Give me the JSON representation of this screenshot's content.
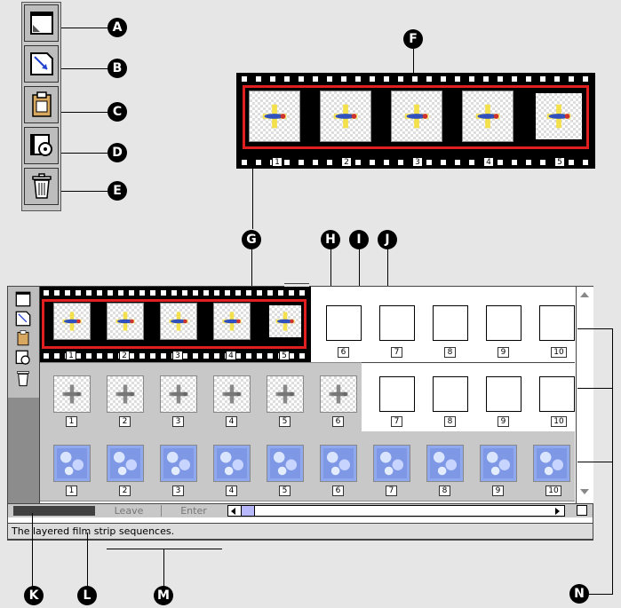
{
  "palette": {
    "tools": [
      {
        "name": "frame-tool",
        "icon": "frame-icon"
      },
      {
        "name": "arrow-tool",
        "icon": "arrow-icon"
      },
      {
        "name": "clipboard-tool",
        "icon": "clipboard-icon"
      },
      {
        "name": "film-reel-tool",
        "icon": "film-reel-icon"
      },
      {
        "name": "trash-tool",
        "icon": "trash-icon"
      }
    ]
  },
  "callouts": {
    "a": "A",
    "b": "B",
    "c": "C",
    "d": "D",
    "e": "E",
    "f": "F",
    "g": "G",
    "h": "H",
    "i": "I",
    "j": "J",
    "k": "K",
    "l": "L",
    "m": "M",
    "n": "N"
  },
  "big_strip": {
    "frame_numbers": [
      "1",
      "2",
      "3",
      "4",
      "5"
    ],
    "selected_frame": "5"
  },
  "window": {
    "row1_numbers": [
      "1",
      "2",
      "3",
      "4",
      "5",
      "6",
      "7",
      "8",
      "9",
      "10"
    ],
    "row2_numbers": [
      "1",
      "2",
      "3",
      "4",
      "5",
      "6",
      "7",
      "8",
      "9",
      "10"
    ],
    "row3_numbers": [
      "1",
      "2",
      "3",
      "4",
      "5",
      "6",
      "7",
      "8",
      "9",
      "10"
    ],
    "buttons": {
      "leave": "Leave",
      "enter": "Enter"
    },
    "status_text": "The layered film strip sequences."
  },
  "colors": {
    "selection_red": "#e02020",
    "accent_blue": "#7e98e6"
  }
}
